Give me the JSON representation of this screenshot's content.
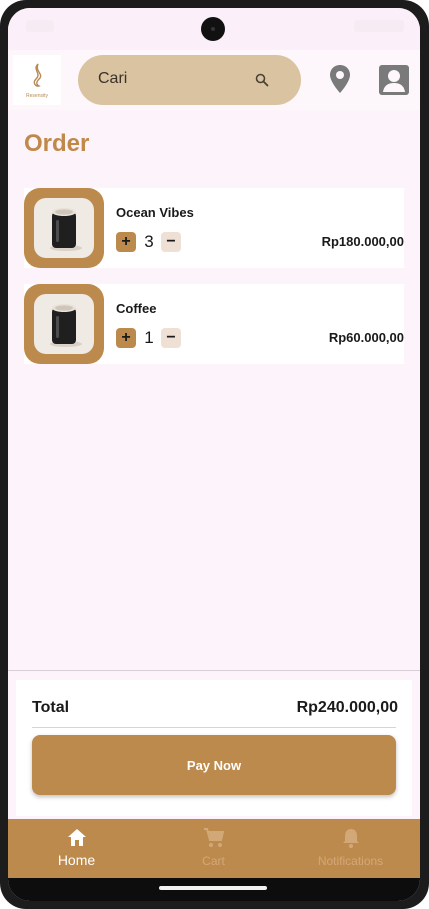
{
  "header": {
    "logo_text": "Resensity",
    "search_placeholder": "Cari"
  },
  "page": {
    "title": "Order"
  },
  "items": [
    {
      "name": "Ocean Vibes",
      "qty": "3",
      "price": "Rp180.000,00",
      "plus": "+",
      "minus": "−"
    },
    {
      "name": "Coffee",
      "qty": "1",
      "price": "Rp60.000,00",
      "plus": "+",
      "minus": "−"
    }
  ],
  "summary": {
    "total_label": "Total",
    "total_value": "Rp240.000,00",
    "pay_button": "Pay Now"
  },
  "nav": {
    "home": "Home",
    "cart": "Cart",
    "notifications": "Notifications",
    "active": "Home"
  },
  "colors": {
    "accent": "#bd8a4d",
    "search_bg": "#d9c3a0",
    "background": "#fdf3fb",
    "title": "#c0894a"
  },
  "icons": [
    "search-icon",
    "location-pin-icon",
    "account-icon",
    "home-icon",
    "cart-icon",
    "bell-icon"
  ]
}
